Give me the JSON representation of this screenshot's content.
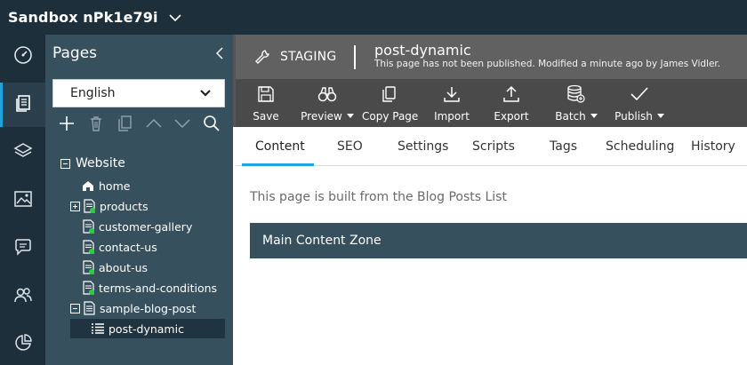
{
  "app": {
    "sandbox_name": "Sandbox nPk1e79i"
  },
  "rail": {
    "items": [
      {
        "icon": "dashboard-icon"
      },
      {
        "icon": "pages-icon",
        "active": true
      },
      {
        "icon": "layers-icon"
      },
      {
        "icon": "image-icon"
      },
      {
        "icon": "chat-icon"
      },
      {
        "icon": "users-icon"
      },
      {
        "icon": "analytics-icon"
      }
    ]
  },
  "pages_panel": {
    "title": "Pages",
    "language": "English",
    "tools": [
      "add-icon",
      "delete-icon",
      "copy-icon",
      "move-up-icon",
      "move-down-icon",
      "search-icon"
    ],
    "tree": {
      "root": "Website",
      "items": [
        {
          "label": "home",
          "icon": "home-page-icon"
        },
        {
          "label": "products",
          "icon": "page-published-icon",
          "expander": "plus"
        },
        {
          "label": "customer-gallery",
          "icon": "page-published-icon"
        },
        {
          "label": "contact-us",
          "icon": "page-published-icon"
        },
        {
          "label": "about-us",
          "icon": "page-published-icon"
        },
        {
          "label": "terms-and-conditions",
          "icon": "page-published-icon"
        },
        {
          "label": "sample-blog-post",
          "icon": "page-icon",
          "expander": "minus"
        },
        {
          "label": "post-dynamic",
          "icon": "list-icon",
          "selected": true
        }
      ]
    }
  },
  "header": {
    "environment": "STAGING",
    "page_name": "post-dynamic",
    "status": "This page has not been published. Modified a minute ago by James Vidler."
  },
  "toolbar": {
    "buttons": [
      {
        "label": "Save",
        "icon": "save-icon"
      },
      {
        "label": "Preview",
        "icon": "binoculars-icon",
        "dropdown": true
      },
      {
        "label": "Copy Page",
        "icon": "copy-page-icon"
      },
      {
        "label": "Import",
        "icon": "import-icon"
      },
      {
        "label": "Export",
        "icon": "export-icon"
      },
      {
        "label": "Batch",
        "icon": "database-icon",
        "dropdown": true
      },
      {
        "label": "Publish",
        "icon": "check-icon",
        "dropdown": true
      }
    ]
  },
  "tabs": [
    "Content",
    "SEO",
    "Settings",
    "Scripts",
    "Tags",
    "Scheduling",
    "History"
  ],
  "active_tab": "Content",
  "content": {
    "note": "This page is built from the Blog Posts List",
    "zone_title": "Main Content Zone"
  },
  "colors": {
    "topbar": "#1c2f3b",
    "panel": "#37505e",
    "accent": "#1fa3dc",
    "published_check": "#2ecc40",
    "header_bg": "#616161",
    "toolbar_bg": "#4a4a4a"
  }
}
